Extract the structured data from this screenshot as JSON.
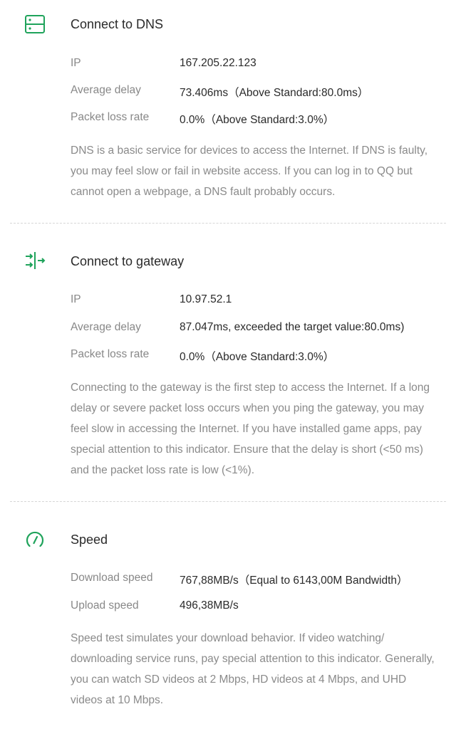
{
  "accent_color": "#1fa35b",
  "dns": {
    "icon": "server-icon",
    "title": "Connect to DNS",
    "rows": [
      {
        "label": "IP",
        "value": "167.205.22.123"
      },
      {
        "label": "Average delay",
        "value": "73.406ms（Above Standard:80.0ms）"
      },
      {
        "label": "Packet loss rate",
        "value": "0.0%（Above Standard:3.0%）"
      }
    ],
    "description": "DNS is a basic service for devices to access the Internet. If DNS is faulty, you may feel slow or fail in website access. If you can log in to QQ but cannot open a webpage, a DNS fault probably occurs."
  },
  "gateway": {
    "icon": "gateway-icon",
    "title": "Connect to gateway",
    "rows": [
      {
        "label": "IP",
        "value": "10.97.52.1"
      },
      {
        "label": "Average delay",
        "value": "87.047ms, exceeded the target value:80.0ms)"
      },
      {
        "label": "Packet loss rate",
        "value": "0.0%（Above Standard:3.0%）"
      }
    ],
    "description": "Connecting to the gateway is the first step to access the Internet. If a long delay or severe packet loss occurs when you ping the gateway, you may feel slow in accessing the Internet. If you have installed game apps, pay special attention to this indicator. Ensure that the delay is short (<50 ms) and the packet loss rate is low (<1%)."
  },
  "speed": {
    "icon": "speedometer-icon",
    "title": "Speed",
    "rows": [
      {
        "label": "Download speed",
        "value": "767,88MB/s（Equal to 6143,00M Bandwidth）"
      },
      {
        "label": "Upload speed",
        "value": "496,38MB/s"
      }
    ],
    "description": "Speed test simulates your download behavior. If video watching/ downloading service runs, pay special attention to this indicator. Generally, you can watch SD videos at 2 Mbps, HD videos at 4 Mbps, and UHD videos at 10 Mbps."
  }
}
